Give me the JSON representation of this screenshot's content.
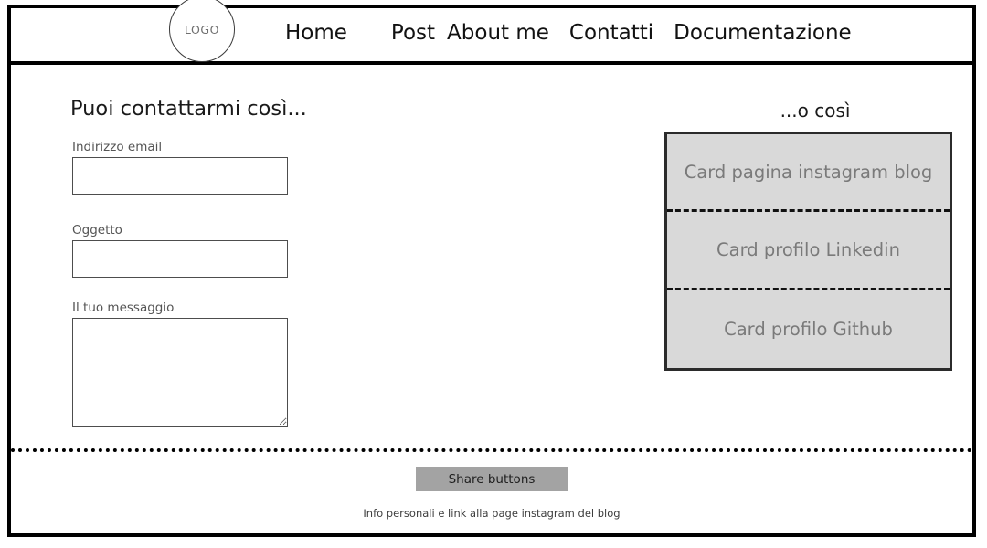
{
  "navbar": {
    "logo": {
      "text": "LOGO",
      "icon": "logo-circle-icon"
    },
    "links": [
      {
        "label": "Home"
      },
      {
        "label": "Post"
      },
      {
        "label": "About me"
      },
      {
        "label": "Contatti"
      },
      {
        "label": "Documentazione"
      }
    ]
  },
  "form": {
    "heading": "Puoi contattarmi così...",
    "fields": [
      {
        "label": "Indirizzo email",
        "value": "",
        "placeholder": ""
      },
      {
        "label": "Oggetto",
        "value": "",
        "placeholder": ""
      },
      {
        "label": "Il tuo messaggio",
        "value": "",
        "placeholder": ""
      }
    ]
  },
  "cards": {
    "heading": "...o così",
    "items": [
      {
        "label": "Card pagina instagram blog"
      },
      {
        "label": "Card profilo Linkedin"
      },
      {
        "label": "Card profilo Github"
      }
    ]
  },
  "footer": {
    "share_label": "Share buttons",
    "note": "Info personali e link alla page instagram del blog"
  },
  "colors": {
    "frame": "#000000",
    "card_fill": "#d9d9d9",
    "card_text": "#7a7a7a",
    "share_button": "#a3a3a3"
  }
}
